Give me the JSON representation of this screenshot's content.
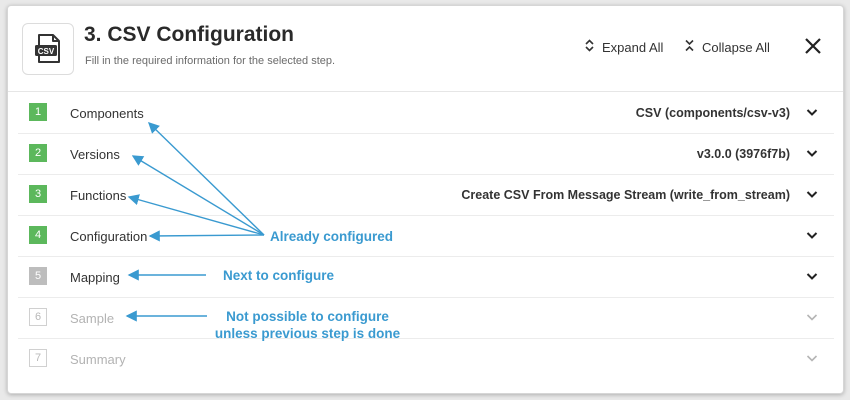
{
  "header": {
    "title": "3. CSV Configuration",
    "subtitle": "Fill in the required information for the selected step.",
    "app_icon": "csv-file-icon",
    "expand_all_label": "Expand All",
    "collapse_all_label": "Collapse All"
  },
  "steps": [
    {
      "number": "1",
      "label": "Components",
      "value": "CSV (components/csv-v3)",
      "status": "configured"
    },
    {
      "number": "2",
      "label": "Versions",
      "value": "v3.0.0 (3976f7b)",
      "status": "configured"
    },
    {
      "number": "3",
      "label": "Functions",
      "value": "Create CSV From Message Stream (write_from_stream)",
      "status": "configured"
    },
    {
      "number": "4",
      "label": "Configuration",
      "value": "",
      "status": "configured"
    },
    {
      "number": "5",
      "label": "Mapping",
      "value": "",
      "status": "next"
    },
    {
      "number": "6",
      "label": "Sample",
      "value": "",
      "status": "disabled"
    },
    {
      "number": "7",
      "label": "Summary",
      "value": "",
      "status": "disabled"
    }
  ],
  "annotations": {
    "already_configured": "Already configured",
    "next_to_configure": "Next to configure",
    "not_possible_line1": "Not possible to configure",
    "not_possible_line2": "unless previous step is done"
  },
  "colors": {
    "configured": "#5cb85c",
    "next": "#bdbdbd",
    "disabled_border": "#d0d0d0",
    "annotation": "#3a9ad0"
  }
}
